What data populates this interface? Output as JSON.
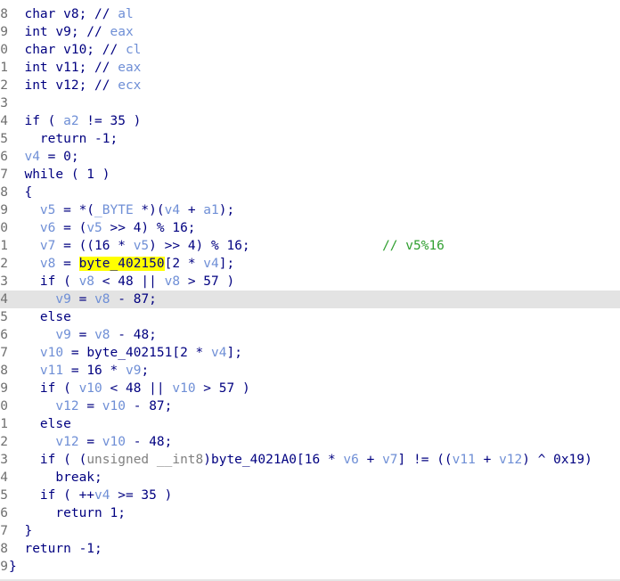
{
  "editor": {
    "current_line": 16,
    "lines": [
      {
        "num": "8",
        "tokens": [
          {
            "t": "  char v8; // ",
            "c": "plain"
          },
          {
            "t": "al",
            "c": "var"
          }
        ]
      },
      {
        "num": "9",
        "tokens": [
          {
            "t": "  int v9; // ",
            "c": "plain"
          },
          {
            "t": "eax",
            "c": "var"
          }
        ]
      },
      {
        "num": "0",
        "tokens": [
          {
            "t": "  char v10; // ",
            "c": "plain"
          },
          {
            "t": "cl",
            "c": "var"
          }
        ]
      },
      {
        "num": "1",
        "tokens": [
          {
            "t": "  int v11; // ",
            "c": "plain"
          },
          {
            "t": "eax",
            "c": "var"
          }
        ]
      },
      {
        "num": "2",
        "tokens": [
          {
            "t": "  int v12; // ",
            "c": "plain"
          },
          {
            "t": "ecx",
            "c": "var"
          }
        ]
      },
      {
        "num": "3",
        "tokens": []
      },
      {
        "num": "4",
        "tokens": [
          {
            "t": "  if ( ",
            "c": "plain"
          },
          {
            "t": "a2",
            "c": "var"
          },
          {
            "t": " != 35 )",
            "c": "plain"
          }
        ]
      },
      {
        "num": "5",
        "tokens": [
          {
            "t": "    return -1;",
            "c": "plain"
          }
        ]
      },
      {
        "num": "6",
        "tokens": [
          {
            "t": "  ",
            "c": "plain"
          },
          {
            "t": "v4",
            "c": "var"
          },
          {
            "t": " = 0;",
            "c": "plain"
          }
        ]
      },
      {
        "num": "7",
        "tokens": [
          {
            "t": "  while ( 1 )",
            "c": "plain"
          }
        ]
      },
      {
        "num": "8",
        "tokens": [
          {
            "t": "  {",
            "c": "plain"
          }
        ]
      },
      {
        "num": "9",
        "tokens": [
          {
            "t": "    ",
            "c": "plain"
          },
          {
            "t": "v5",
            "c": "var"
          },
          {
            "t": " = *(",
            "c": "plain"
          },
          {
            "t": "_BYTE",
            "c": "var"
          },
          {
            "t": " *)(",
            "c": "plain"
          },
          {
            "t": "v4",
            "c": "var"
          },
          {
            "t": " + ",
            "c": "plain"
          },
          {
            "t": "a1",
            "c": "var"
          },
          {
            "t": ");",
            "c": "plain"
          }
        ]
      },
      {
        "num": "0",
        "tokens": [
          {
            "t": "    ",
            "c": "plain"
          },
          {
            "t": "v6",
            "c": "var"
          },
          {
            "t": " = (",
            "c": "plain"
          },
          {
            "t": "v5",
            "c": "var"
          },
          {
            "t": " >> 4) % 16;",
            "c": "plain"
          }
        ]
      },
      {
        "num": "1",
        "tokens": [
          {
            "t": "    ",
            "c": "plain"
          },
          {
            "t": "v7",
            "c": "var"
          },
          {
            "t": " = ((16 * ",
            "c": "plain"
          },
          {
            "t": "v5",
            "c": "var"
          },
          {
            "t": ") >> 4) % 16;",
            "c": "plain"
          },
          {
            "t": "                 // v5%16",
            "c": "comment"
          }
        ]
      },
      {
        "num": "2",
        "tokens": [
          {
            "t": "    ",
            "c": "plain"
          },
          {
            "t": "v8",
            "c": "var"
          },
          {
            "t": " = ",
            "c": "plain"
          },
          {
            "t": "byte_402150",
            "c": "hl"
          },
          {
            "t": "[2 * ",
            "c": "plain"
          },
          {
            "t": "v4",
            "c": "var"
          },
          {
            "t": "];",
            "c": "plain"
          }
        ]
      },
      {
        "num": "3",
        "tokens": [
          {
            "t": "    if ( ",
            "c": "plain"
          },
          {
            "t": "v8",
            "c": "var"
          },
          {
            "t": " < 48 || ",
            "c": "plain"
          },
          {
            "t": "v8",
            "c": "var"
          },
          {
            "t": " > 57 )",
            "c": "plain"
          }
        ]
      },
      {
        "num": "4",
        "tokens": [
          {
            "t": "      ",
            "c": "plain"
          },
          {
            "t": "v9",
            "c": "var"
          },
          {
            "t": " = ",
            "c": "plain"
          },
          {
            "t": "v8",
            "c": "var"
          },
          {
            "t": " - 87;",
            "c": "plain"
          }
        ]
      },
      {
        "num": "5",
        "tokens": [
          {
            "t": "    else",
            "c": "plain"
          }
        ]
      },
      {
        "num": "6",
        "tokens": [
          {
            "t": "      ",
            "c": "plain"
          },
          {
            "t": "v9",
            "c": "var"
          },
          {
            "t": " = ",
            "c": "plain"
          },
          {
            "t": "v8",
            "c": "var"
          },
          {
            "t": " - 48;",
            "c": "plain"
          }
        ]
      },
      {
        "num": "7",
        "tokens": [
          {
            "t": "    ",
            "c": "plain"
          },
          {
            "t": "v10",
            "c": "var"
          },
          {
            "t": " = byte_402151[2 * ",
            "c": "plain"
          },
          {
            "t": "v4",
            "c": "var"
          },
          {
            "t": "];",
            "c": "plain"
          }
        ]
      },
      {
        "num": "8",
        "tokens": [
          {
            "t": "    ",
            "c": "plain"
          },
          {
            "t": "v11",
            "c": "var"
          },
          {
            "t": " = 16 * ",
            "c": "plain"
          },
          {
            "t": "v9",
            "c": "var"
          },
          {
            "t": ";",
            "c": "plain"
          }
        ]
      },
      {
        "num": "9",
        "tokens": [
          {
            "t": "    if ( ",
            "c": "plain"
          },
          {
            "t": "v10",
            "c": "var"
          },
          {
            "t": " < 48 || ",
            "c": "plain"
          },
          {
            "t": "v10",
            "c": "var"
          },
          {
            "t": " > 57 )",
            "c": "plain"
          }
        ]
      },
      {
        "num": "0",
        "tokens": [
          {
            "t": "      ",
            "c": "plain"
          },
          {
            "t": "v12",
            "c": "var"
          },
          {
            "t": " = ",
            "c": "plain"
          },
          {
            "t": "v10",
            "c": "var"
          },
          {
            "t": " - 87;",
            "c": "plain"
          }
        ]
      },
      {
        "num": "1",
        "tokens": [
          {
            "t": "    else",
            "c": "plain"
          }
        ]
      },
      {
        "num": "2",
        "tokens": [
          {
            "t": "      ",
            "c": "plain"
          },
          {
            "t": "v12",
            "c": "var"
          },
          {
            "t": " = ",
            "c": "plain"
          },
          {
            "t": "v10",
            "c": "var"
          },
          {
            "t": " - 48;",
            "c": "plain"
          }
        ]
      },
      {
        "num": "3",
        "tokens": [
          {
            "t": "    if ( (",
            "c": "plain"
          },
          {
            "t": "unsigned __int8",
            "c": "gray"
          },
          {
            "t": ")byte_4021A0[16 * ",
            "c": "plain"
          },
          {
            "t": "v6",
            "c": "var"
          },
          {
            "t": " + ",
            "c": "plain"
          },
          {
            "t": "v7",
            "c": "var"
          },
          {
            "t": "] != ((",
            "c": "plain"
          },
          {
            "t": "v11",
            "c": "var"
          },
          {
            "t": " + ",
            "c": "plain"
          },
          {
            "t": "v12",
            "c": "var"
          },
          {
            "t": ") ^ 0x19)",
            "c": "plain"
          }
        ]
      },
      {
        "num": "4",
        "tokens": [
          {
            "t": "      break;",
            "c": "plain"
          }
        ]
      },
      {
        "num": "5",
        "tokens": [
          {
            "t": "    if ( ++",
            "c": "plain"
          },
          {
            "t": "v4",
            "c": "var"
          },
          {
            "t": " >= 35 )",
            "c": "plain"
          }
        ]
      },
      {
        "num": "6",
        "tokens": [
          {
            "t": "      return 1;",
            "c": "plain"
          }
        ]
      },
      {
        "num": "7",
        "tokens": [
          {
            "t": "  }",
            "c": "plain"
          }
        ]
      },
      {
        "num": "8",
        "tokens": [
          {
            "t": "  return -1;",
            "c": "plain"
          }
        ]
      },
      {
        "num": "9",
        "tokens": [
          {
            "t": "}",
            "c": "plain"
          }
        ]
      }
    ]
  }
}
